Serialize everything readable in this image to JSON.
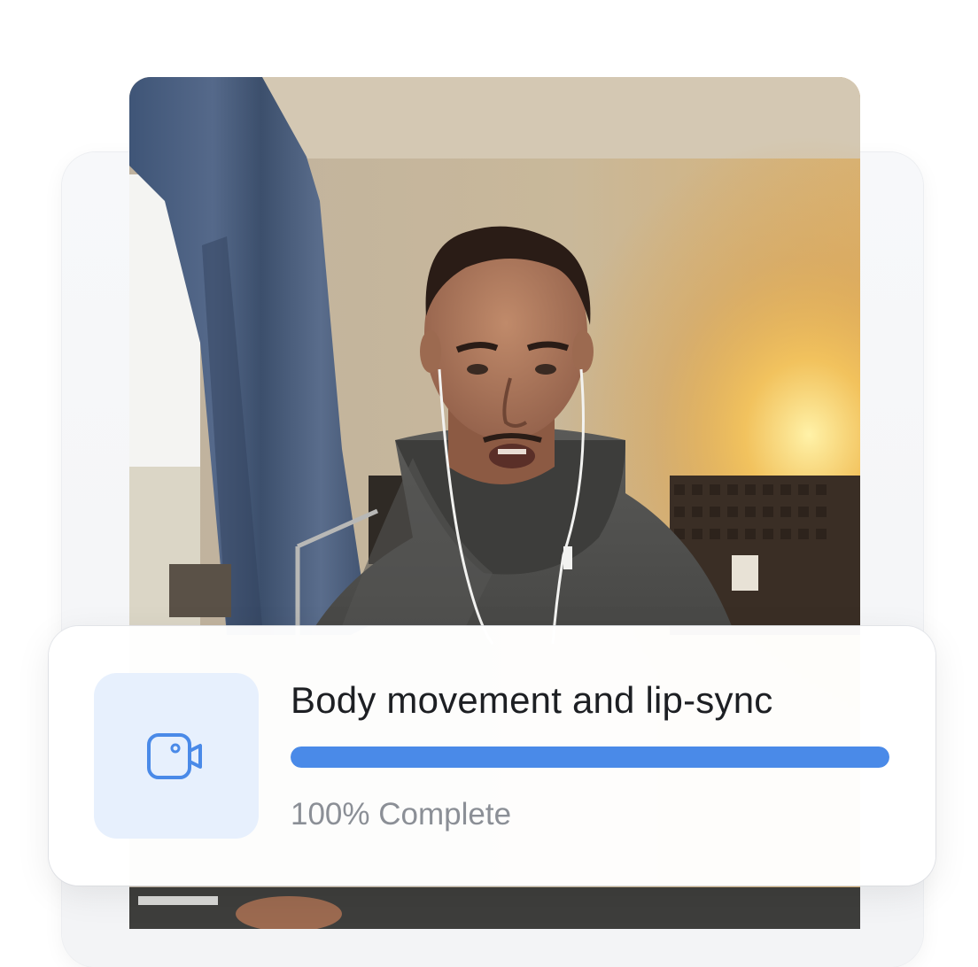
{
  "task": {
    "title": "Body movement and lip-sync",
    "progress_percent": 100,
    "status_text": "100% Complete",
    "icon": "video-camera-icon"
  },
  "colors": {
    "accent": "#4a8ae8",
    "icon_bg": "#e7f0fd",
    "title_text": "#1d1f23",
    "status_text": "#8b8f96"
  }
}
